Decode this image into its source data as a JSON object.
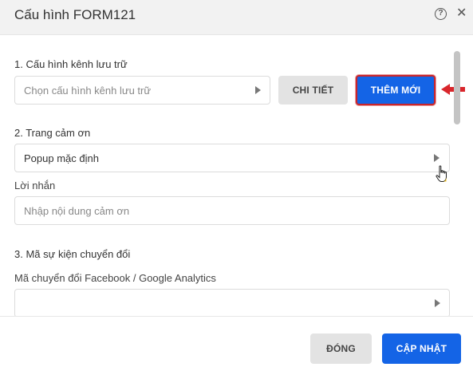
{
  "modal": {
    "title": "Cấu hình FORM121",
    "help_icon": "question-circle-icon",
    "close_icon": "close-icon"
  },
  "section1": {
    "title": "1. Cấu hình kênh lưu trữ",
    "select_placeholder": "Chọn cấu hình kênh lưu trữ",
    "detail_button": "CHI TIẾT",
    "new_button": "THÊM MỚI"
  },
  "section2": {
    "title": "2. Trang cảm ơn",
    "select_value": "Popup mặc định",
    "message_label": "Lời nhắn",
    "message_placeholder": "Nhập nội dung cảm ơn"
  },
  "section3": {
    "title": "3. Mã sự kiện chuyển đổi",
    "tracking_label": "Mã chuyển đổi Facebook / Google Analytics"
  },
  "footer": {
    "close_button": "ĐÓNG",
    "update_button": "CẬP NHẬT"
  },
  "colors": {
    "primary": "#1464e6",
    "highlight": "#d9262c",
    "header_bg": "#f2f2f2"
  }
}
